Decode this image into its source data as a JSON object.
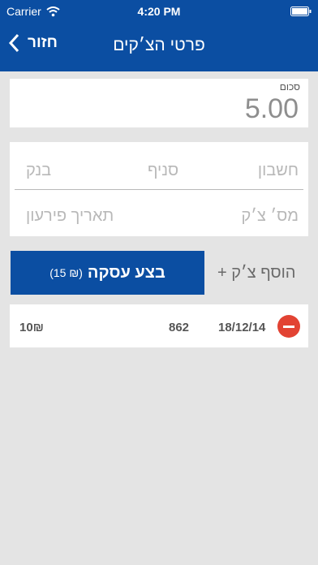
{
  "status": {
    "carrier": "Carrier",
    "time": "4:20 PM"
  },
  "nav": {
    "back_label": "חזור",
    "title": "פרטי הצ׳קים"
  },
  "amount": {
    "label": "סכום",
    "value": "5.00"
  },
  "form": {
    "account_placeholder": "חשבון",
    "branch_placeholder": "סניף",
    "bank_placeholder": "בנק",
    "check_number_placeholder": "מס׳ צ׳ק",
    "due_date_placeholder": "תאריך פירעון"
  },
  "actions": {
    "add_check_label": "+ הוסף צ׳ק",
    "submit_label": "בצע עסקה",
    "submit_fee": "(15 ₪)"
  },
  "checks": [
    {
      "date": "18/12/14",
      "number": "862",
      "amount": "10₪"
    }
  ],
  "colors": {
    "brand": "#0b4ea2",
    "delete": "#e24333",
    "background": "#e4e4e4"
  }
}
